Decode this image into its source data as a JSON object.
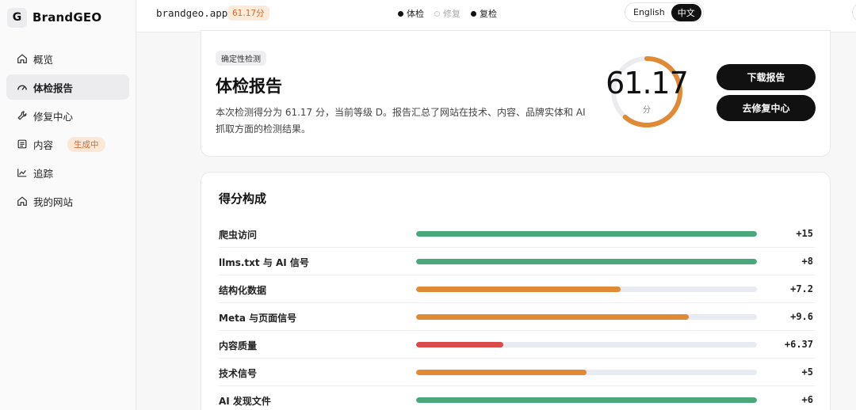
{
  "brand": {
    "logo_letter": "G",
    "name": "BrandGEO"
  },
  "sidebar": {
    "items": [
      {
        "label": "概览",
        "icon": "home-icon"
      },
      {
        "label": "体检报告",
        "icon": "gauge-icon",
        "active": true
      },
      {
        "label": "修复中心",
        "icon": "wrench-icon"
      },
      {
        "label": "内容",
        "icon": "document-icon",
        "badge": "生成中"
      },
      {
        "label": "追踪",
        "icon": "trend-icon"
      },
      {
        "label": "我的网站",
        "icon": "home-icon"
      }
    ]
  },
  "topbar": {
    "domain": "brandgeo.app",
    "score_pill": "61.17分",
    "steps": [
      {
        "label": "体检",
        "state": "done"
      },
      {
        "label": "修复",
        "state": "pending"
      },
      {
        "label": "复检",
        "state": "done"
      }
    ],
    "lang": {
      "en": "English",
      "zh": "中文",
      "active": "zh"
    }
  },
  "report": {
    "tag": "确定性检测",
    "title": "体检报告",
    "description": "本次检测得分为 61.17 分，当前等级 D。报告汇总了网站在技术、内容、品牌实体和 AI 抓取方面的检测结果。",
    "score": "61.17",
    "score_fraction": 0.6117,
    "score_unit": "分",
    "download_button": "下载报告",
    "fix_button": "去修复中心"
  },
  "breakdown": {
    "title": "得分构成",
    "rows": [
      {
        "label": "爬虫访问",
        "value": "+15",
        "fill": 1.0,
        "color": "#4aa87c"
      },
      {
        "label": "llms.txt 与 AI 信号",
        "value": "+8",
        "fill": 1.0,
        "color": "#4aa87c"
      },
      {
        "label": "结构化数据",
        "value": "+7.2",
        "fill": 0.6,
        "color": "#e08a35"
      },
      {
        "label": "Meta 与页面信号",
        "value": "+9.6",
        "fill": 0.8,
        "color": "#e08a35"
      },
      {
        "label": "内容质量",
        "value": "+6.37",
        "fill": 0.255,
        "color": "#d94a4a"
      },
      {
        "label": "技术信号",
        "value": "+5",
        "fill": 0.5,
        "color": "#e08a35"
      },
      {
        "label": "AI 发现文件",
        "value": "+6",
        "fill": 1.0,
        "color": "#4aa87c"
      }
    ]
  },
  "colors": {
    "accent_orange": "#e08a35",
    "good_green": "#4aa87c",
    "bad_red": "#d94a4a",
    "track": "#e8ebf2"
  }
}
